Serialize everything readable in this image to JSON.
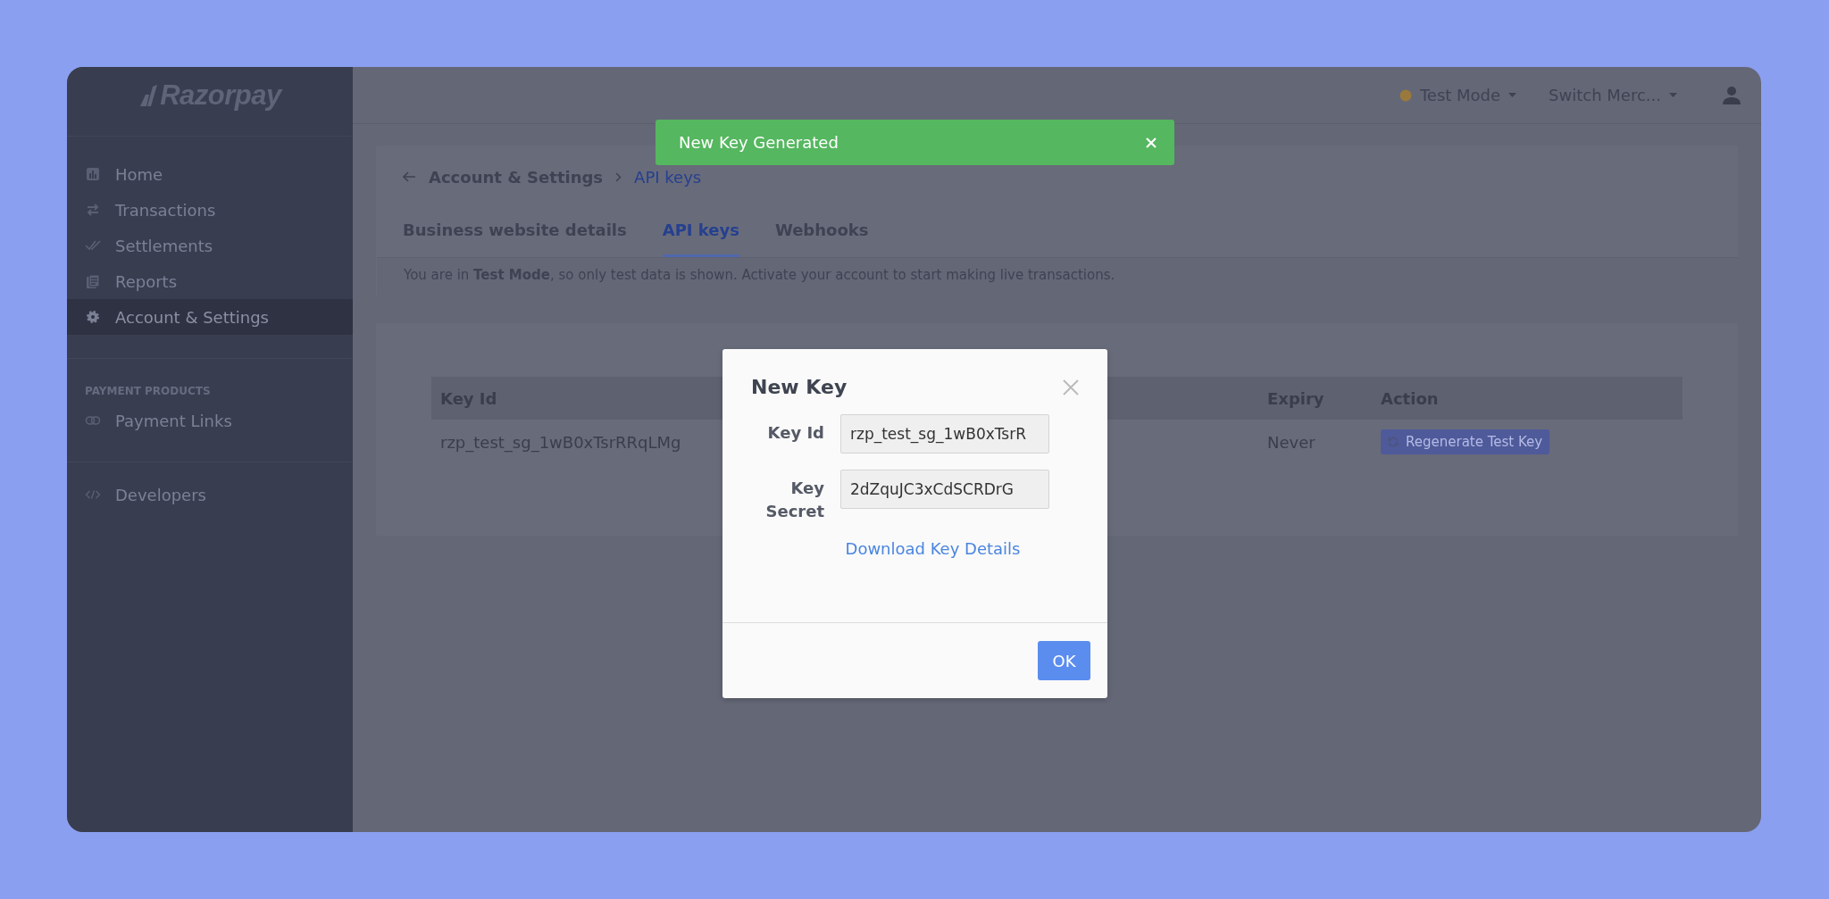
{
  "logo": {
    "text": "Razorpay"
  },
  "sidebar": {
    "groups": [
      {
        "items": [
          {
            "label": "Home",
            "kind": "chart",
            "selected": false
          },
          {
            "label": "Transactions",
            "kind": "swap",
            "selected": false
          },
          {
            "label": "Settlements",
            "kind": "checks",
            "selected": false
          },
          {
            "label": "Reports",
            "kind": "docs",
            "selected": false
          },
          {
            "label": "Account & Settings",
            "kind": "gear",
            "selected": true
          }
        ]
      },
      {
        "heading": "PAYMENT PRODUCTS",
        "items": [
          {
            "label": "Payment Links",
            "kind": "link",
            "selected": false
          }
        ]
      },
      {
        "items": [
          {
            "label": "Developers",
            "kind": "code",
            "selected": false
          }
        ]
      }
    ]
  },
  "topbar": {
    "mode": "Test Mode",
    "merchant": "Switch Merc..."
  },
  "toast": {
    "message": "New Key Generated"
  },
  "breadcrumb": [
    "Account & Settings",
    "API keys"
  ],
  "tabs": [
    {
      "label": "Business website details",
      "selected": false
    },
    {
      "label": "API keys",
      "selected": true
    },
    {
      "label": "Webhooks",
      "selected": false
    }
  ],
  "notice": "You are in **Test Mode**, so only test data is shown. Activate your account to start making live transactions.",
  "table": {
    "columns": [
      "Key Id",
      "Expiry",
      "Action"
    ],
    "rows": [
      {
        "key_id": "rzp_test_sg_1wB0xTsrRRqLMg",
        "expiry": "Never",
        "action": "Regenerate Test Key"
      }
    ]
  },
  "dialog": {
    "title": "New Key",
    "fields": [
      {
        "label": "Key Id",
        "value": "rzp_test_sg_1wB0xTsrR"
      },
      {
        "label": "Key Secret",
        "value": "2dZquJC3xCdSCRDrG"
      }
    ],
    "link": "Download Key Details",
    "button": "OK"
  }
}
